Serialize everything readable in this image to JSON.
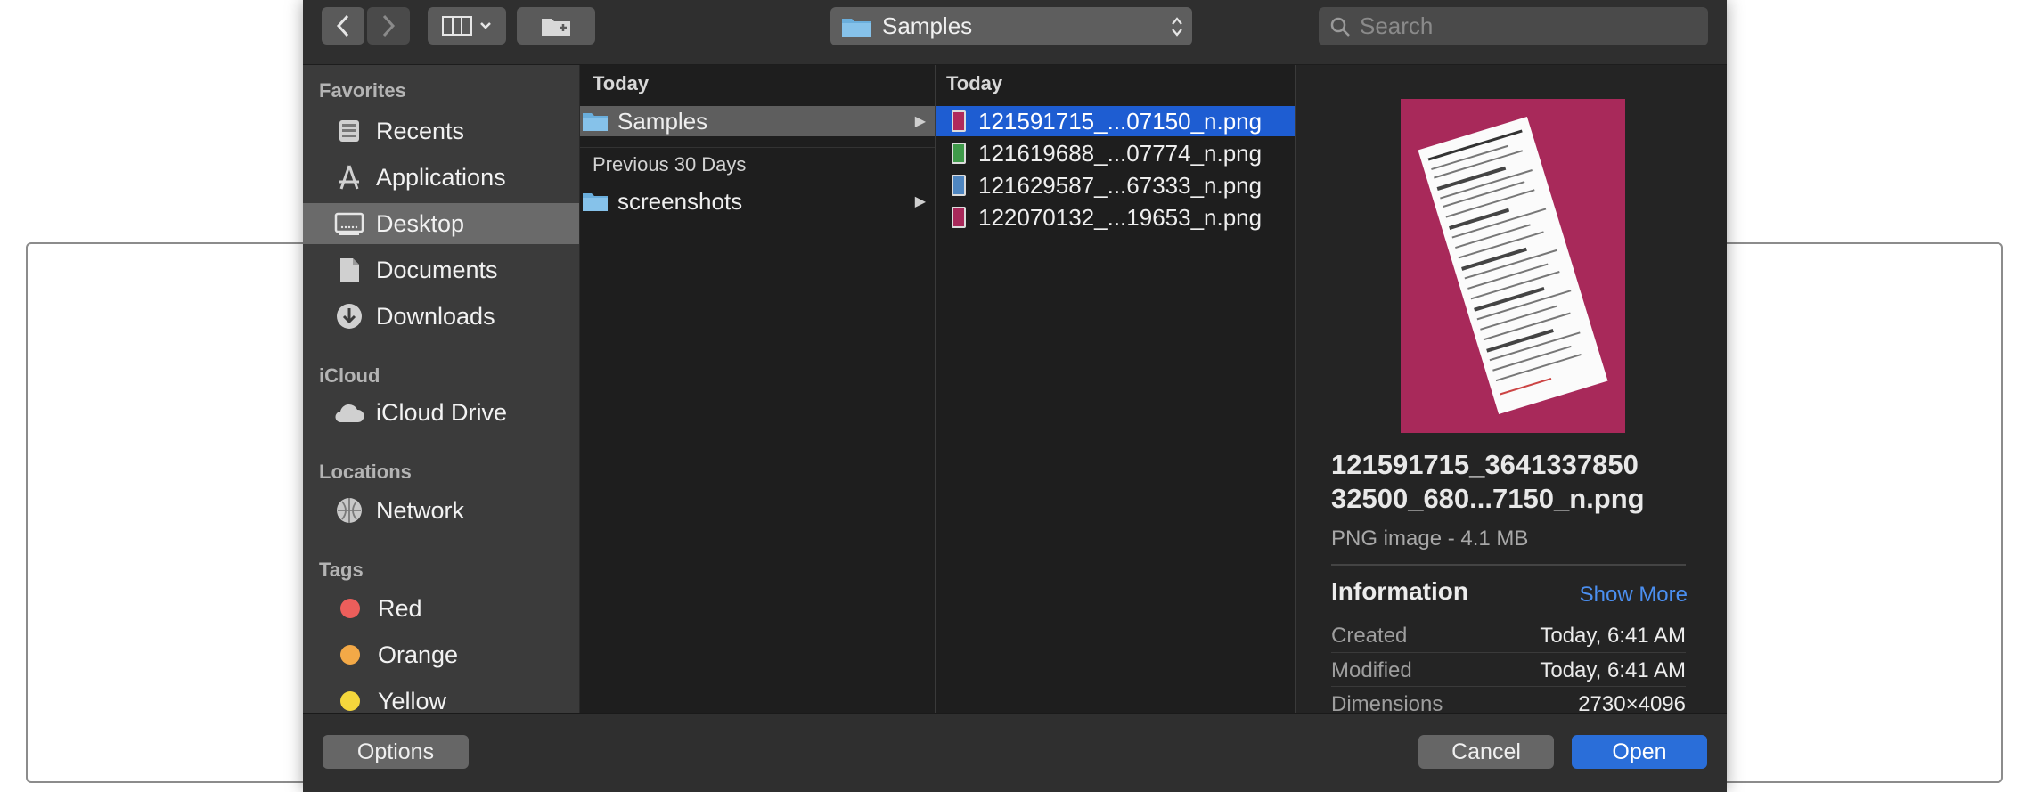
{
  "toolbar": {
    "view_mode": "columns",
    "path_label": "Samples",
    "search_placeholder": "Search"
  },
  "sidebar": {
    "favorites_label": "Favorites",
    "favorites": [
      {
        "label": "Recents",
        "icon": "recents-icon"
      },
      {
        "label": "Applications",
        "icon": "applications-icon"
      },
      {
        "label": "Desktop",
        "icon": "desktop-icon",
        "selected": true
      },
      {
        "label": "Documents",
        "icon": "documents-icon"
      },
      {
        "label": "Downloads",
        "icon": "downloads-icon"
      }
    ],
    "icloud_label": "iCloud",
    "icloud": [
      {
        "label": "iCloud Drive",
        "icon": "cloud-icon"
      }
    ],
    "locations_label": "Locations",
    "locations": [
      {
        "label": "Network",
        "icon": "network-icon"
      }
    ],
    "tags_label": "Tags",
    "tags": [
      {
        "label": "Red",
        "color": "#ec5e5b"
      },
      {
        "label": "Orange",
        "color": "#f3a947"
      },
      {
        "label": "Yellow",
        "color": "#f5d73c"
      }
    ]
  },
  "column1": {
    "heading_today": "Today",
    "today_items": [
      {
        "label": "Samples",
        "icon": "folder-icon",
        "selected": true
      }
    ],
    "heading_prev": "Previous 30 Days",
    "prev_items": [
      {
        "label": "screenshots",
        "icon": "folder-icon"
      }
    ]
  },
  "column2": {
    "heading": "Today",
    "files": [
      {
        "label": "121591715_...07150_n.png",
        "thumb_color": "#b02a5c",
        "selected": true
      },
      {
        "label": "121619688_...07774_n.png",
        "thumb_color": "#3f9a4a"
      },
      {
        "label": "121629587_...67333_n.png",
        "thumb_color": "#4f86c0"
      },
      {
        "label": "122070132_...19653_n.png",
        "thumb_color": "#a8295a"
      }
    ]
  },
  "preview": {
    "name": "121591715_3641337850 32500_680...7150_n.png",
    "kind": "PNG image - 4.1 MB",
    "info_label": "Information",
    "show_more": "Show More",
    "rows": [
      {
        "key": "Created",
        "value": "Today, 6:41 AM"
      },
      {
        "key": "Modified",
        "value": "Today, 6:41 AM"
      },
      {
        "key": "Dimensions",
        "value": "2730×4096"
      }
    ]
  },
  "footer": {
    "options_label": "Options",
    "cancel_label": "Cancel",
    "open_label": "Open"
  }
}
